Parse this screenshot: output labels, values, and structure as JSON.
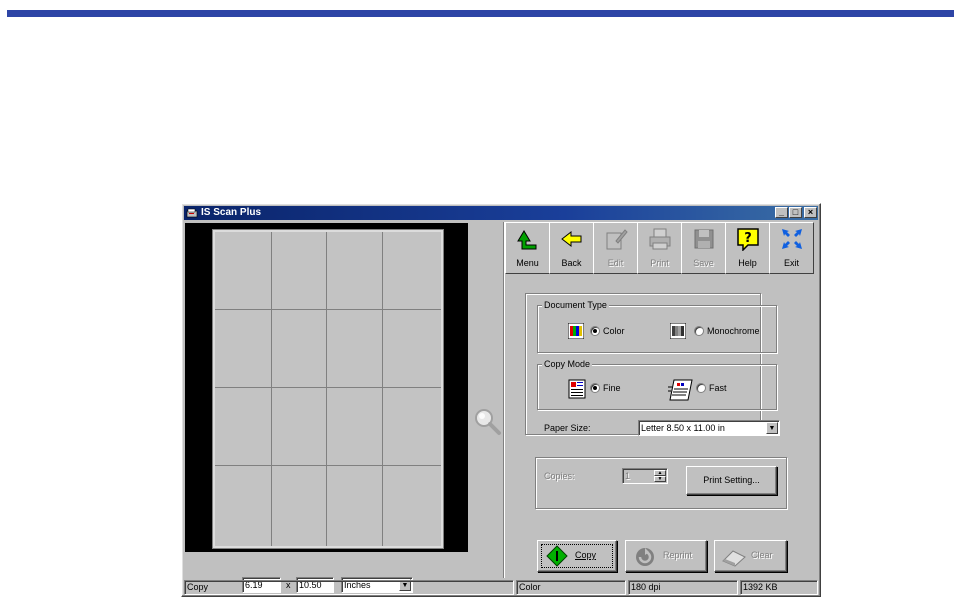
{
  "window": {
    "title": "IS Scan Plus",
    "controls": {
      "minimize": "_",
      "maximize": "□",
      "close": "×"
    }
  },
  "toolbar": {
    "buttons": [
      {
        "label": "Menu",
        "icon": "green-up-arrow-icon",
        "enabled": true
      },
      {
        "label": "Back",
        "icon": "yellow-left-arrow-icon",
        "enabled": true
      },
      {
        "label": "Edit",
        "icon": "edit-icon",
        "enabled": false
      },
      {
        "label": "Print",
        "icon": "printer-icon",
        "enabled": false
      },
      {
        "label": "Save",
        "icon": "floppy-disk-icon",
        "enabled": false
      },
      {
        "label": "Help",
        "icon": "help-question-icon",
        "enabled": true
      },
      {
        "label": "Exit",
        "icon": "exit-arrows-icon",
        "enabled": true
      }
    ]
  },
  "preview": {
    "width": "6.19",
    "x_label": "x",
    "height": "10.50",
    "unit": "Inches",
    "unit_arrow": "▼"
  },
  "document_type": {
    "title": "Document Type",
    "options": [
      {
        "label": "Color",
        "selected": true
      },
      {
        "label": "Monochrome",
        "selected": false
      }
    ]
  },
  "copy_mode": {
    "title": "Copy Mode",
    "options": [
      {
        "label": "Fine",
        "selected": true
      },
      {
        "label": "Fast",
        "selected": false
      }
    ]
  },
  "paper_size": {
    "label": "Paper Size:",
    "value": "Letter 8.50 x 11.00 in",
    "arrow": "▼"
  },
  "copies": {
    "label": "Copies:",
    "value": "1",
    "up": "▲",
    "down": "▼",
    "print_setting_label": "Print Setting..."
  },
  "actions": {
    "copy": "Copy",
    "reprint": "Reprint",
    "clear": "Clear"
  },
  "status": {
    "mode": "Copy",
    "color": "Color",
    "dpi": "180 dpi",
    "size": "1392 KB"
  },
  "colors": {
    "top_bar": "#2e45a6",
    "title_bar": "#0a246a",
    "face": "#c0c0c0"
  }
}
